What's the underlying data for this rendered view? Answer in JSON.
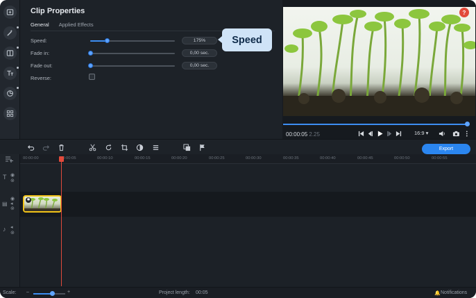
{
  "props": {
    "title": "Clip Properties",
    "tabs": [
      "General",
      "Applied Effects"
    ],
    "speed_label": "Speed:",
    "speed_value": "175%",
    "speed_level": 0.2,
    "fadein_label": "Fade in:",
    "fadein_value": "0,00 sec.",
    "fadein_level": 0,
    "fadeout_label": "Fade out:",
    "fadeout_value": "0,00 sec.",
    "fadeout_level": 0,
    "reverse_label": "Reverse:",
    "reverse_checked": false
  },
  "callout": "Speed",
  "preview": {
    "help": "?",
    "time": "00:00:05",
    "frames": "2.25",
    "aspect": "16:9 ▾",
    "progress": 0.98
  },
  "toolbar": {
    "export_label": "Export"
  },
  "ruler": {
    "labels": [
      "00:00:00",
      "00:00:05",
      "00:00:10",
      "00:00:15",
      "00:00:20",
      "00:00:25",
      "00:00:30",
      "00:00:35",
      "00:00:40",
      "00:00:45",
      "00:00:50",
      "00:00:55"
    ]
  },
  "status": {
    "scale_label": "Scale:",
    "project_length_label": "Project length:",
    "project_length_value": "00:05",
    "notifications_label": "Notifications"
  },
  "colors": {
    "accent": "#3d8ef3",
    "playhead": "#e24a3b",
    "clip_border": "#f2c318",
    "callout_bg": "#cfe3f7"
  }
}
